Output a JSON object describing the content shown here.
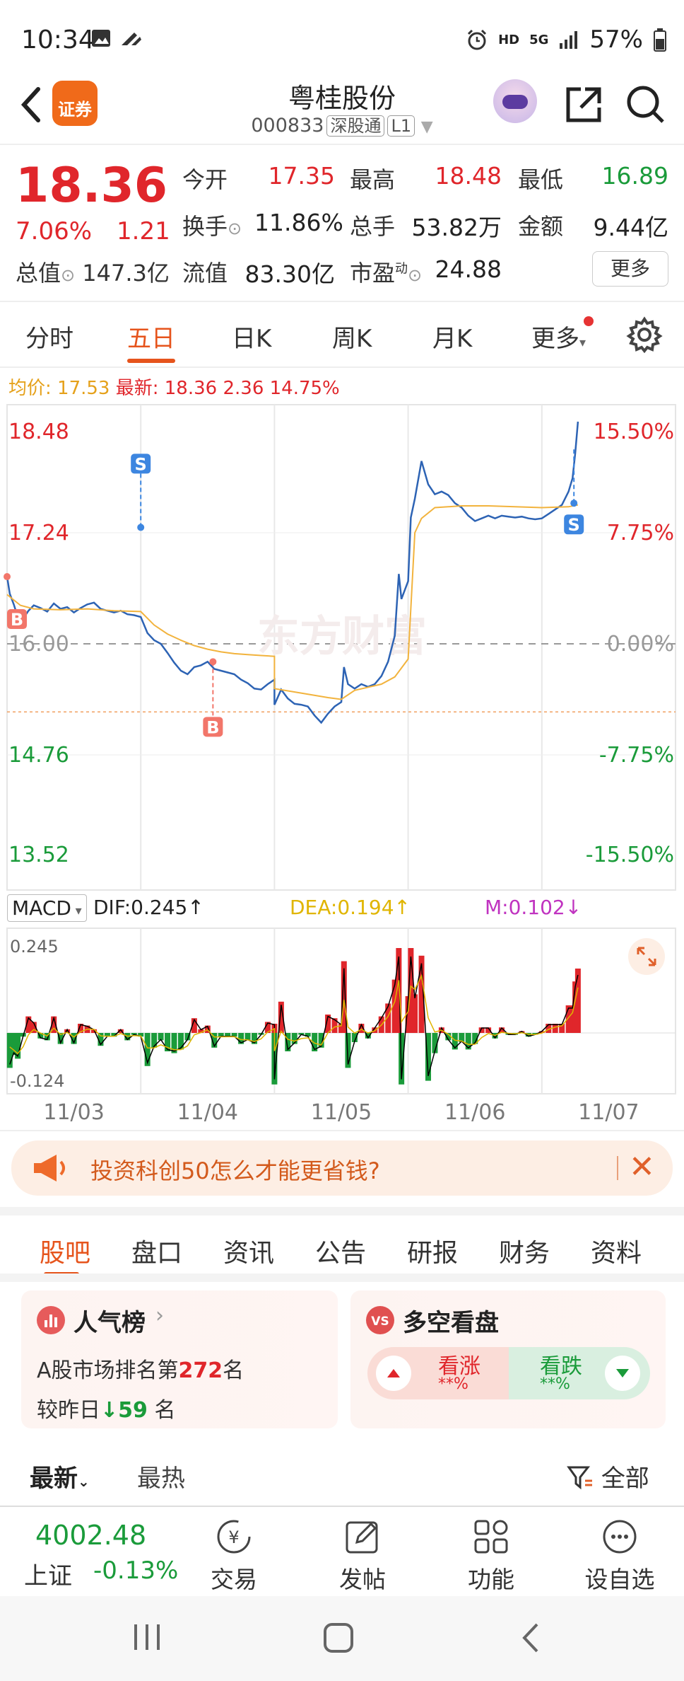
{
  "status_bar": {
    "time": "10:34",
    "network": "HD",
    "signal": "5G",
    "battery": "57%"
  },
  "header": {
    "logo_text": "证券",
    "stock_name": "粤桂股份",
    "stock_code": "000833",
    "market_tag": "深股通",
    "level_tag": "L1"
  },
  "quote": {
    "price": "18.36",
    "change_pct": "7.06%",
    "change": "1.21",
    "open_label": "今开",
    "open": "17.35",
    "high_label": "最高",
    "high": "18.48",
    "low_label": "最低",
    "low": "16.89",
    "turnover_label": "换手",
    "turnover": "11.86%",
    "volume_label": "总手",
    "volume": "53.82万",
    "amount_label": "金额",
    "amount": "9.44亿",
    "total_mv_label": "总值",
    "total_mv": "147.3亿",
    "float_mv_label": "流值",
    "float_mv": "83.30亿",
    "pe_label": "市盈",
    "pe_sup": "动",
    "pe": "24.88",
    "more_label": "更多",
    "colors": {
      "up": "#e0262b",
      "down": "#1a9b3a"
    }
  },
  "tabs": [
    "分时",
    "五日",
    "日K",
    "周K",
    "月K",
    "更多"
  ],
  "active_tab": "五日",
  "chart_info": {
    "avg_label": "均价:",
    "avg_value": "17.53",
    "latest_label": "最新:",
    "latest_value": "18.36",
    "latest_change": "2.36",
    "latest_pct": "14.75%"
  },
  "chart_data": {
    "type": "line",
    "y_left_ticks": [
      "18.48",
      "17.24",
      "16.00",
      "14.76",
      "13.52"
    ],
    "y_right_ticks": [
      "15.50%",
      "7.75%",
      "0.00%",
      "-7.75%",
      "-15.50%"
    ],
    "ylim": [
      13.52,
      18.48
    ],
    "prev_close": 16.0,
    "x_labels": [
      "11/03",
      "11/04",
      "11/05",
      "11/06",
      "11/07"
    ],
    "watermark": "东方财富",
    "markers": [
      {
        "label": "S",
        "type": "sell",
        "day": 1.0,
        "price": 17.3
      },
      {
        "label": "B",
        "type": "buy",
        "day": 1.54,
        "price": 15.8
      },
      {
        "label": "B",
        "type": "buy",
        "day": 0.0,
        "price": 16.75
      },
      {
        "label": "S",
        "type": "sell",
        "day": 4.24,
        "price": 17.57
      }
    ],
    "series": [
      {
        "name": "price",
        "color": "#2d63b4",
        "points": [
          [
            0.0,
            16.75
          ],
          [
            0.02,
            16.56
          ],
          [
            0.05,
            16.44
          ],
          [
            0.08,
            16.3
          ],
          [
            0.12,
            16.28
          ],
          [
            0.16,
            16.37
          ],
          [
            0.2,
            16.43
          ],
          [
            0.25,
            16.4
          ],
          [
            0.3,
            16.36
          ],
          [
            0.35,
            16.45
          ],
          [
            0.4,
            16.39
          ],
          [
            0.45,
            16.41
          ],
          [
            0.5,
            16.35
          ],
          [
            0.55,
            16.4
          ],
          [
            0.6,
            16.44
          ],
          [
            0.65,
            16.46
          ],
          [
            0.7,
            16.39
          ],
          [
            0.75,
            16.37
          ],
          [
            0.8,
            16.35
          ],
          [
            0.85,
            16.37
          ],
          [
            0.9,
            16.33
          ],
          [
            0.95,
            16.32
          ],
          [
            1.0,
            16.3
          ],
          [
            1.05,
            16.12
          ],
          [
            1.1,
            16.04
          ],
          [
            1.15,
            16.0
          ],
          [
            1.2,
            15.9
          ],
          [
            1.25,
            15.79
          ],
          [
            1.3,
            15.7
          ],
          [
            1.35,
            15.66
          ],
          [
            1.4,
            15.74
          ],
          [
            1.45,
            15.76
          ],
          [
            1.5,
            15.8
          ],
          [
            1.55,
            15.72
          ],
          [
            1.6,
            15.7
          ],
          [
            1.65,
            15.68
          ],
          [
            1.7,
            15.66
          ],
          [
            1.75,
            15.6
          ],
          [
            1.8,
            15.56
          ],
          [
            1.85,
            15.5
          ],
          [
            1.9,
            15.49
          ],
          [
            1.95,
            15.55
          ],
          [
            2.0,
            15.6
          ],
          [
            2.0,
            15.32
          ],
          [
            2.05,
            15.49
          ],
          [
            2.1,
            15.39
          ],
          [
            2.15,
            15.33
          ],
          [
            2.2,
            15.32
          ],
          [
            2.25,
            15.3
          ],
          [
            2.3,
            15.2
          ],
          [
            2.35,
            15.12
          ],
          [
            2.4,
            15.22
          ],
          [
            2.45,
            15.3
          ],
          [
            2.5,
            15.35
          ],
          [
            2.52,
            15.74
          ],
          [
            2.55,
            15.55
          ],
          [
            2.6,
            15.5
          ],
          [
            2.65,
            15.55
          ],
          [
            2.7,
            15.52
          ],
          [
            2.75,
            15.55
          ],
          [
            2.8,
            15.64
          ],
          [
            2.85,
            15.8
          ],
          [
            2.9,
            16.09
          ],
          [
            2.93,
            16.78
          ],
          [
            2.95,
            16.5
          ],
          [
            3.0,
            16.7
          ],
          [
            3.02,
            17.41
          ],
          [
            3.05,
            17.62
          ],
          [
            3.1,
            18.04
          ],
          [
            3.15,
            17.78
          ],
          [
            3.2,
            17.67
          ],
          [
            3.25,
            17.7
          ],
          [
            3.3,
            17.66
          ],
          [
            3.35,
            17.57
          ],
          [
            3.4,
            17.52
          ],
          [
            3.45,
            17.43
          ],
          [
            3.5,
            17.37
          ],
          [
            3.55,
            17.4
          ],
          [
            3.6,
            17.43
          ],
          [
            3.65,
            17.4
          ],
          [
            3.7,
            17.43
          ],
          [
            3.75,
            17.42
          ],
          [
            3.8,
            17.41
          ],
          [
            3.85,
            17.42
          ],
          [
            3.9,
            17.4
          ],
          [
            3.95,
            17.39
          ],
          [
            4.0,
            17.4
          ],
          [
            4.05,
            17.45
          ],
          [
            4.1,
            17.5
          ],
          [
            4.15,
            17.55
          ],
          [
            4.2,
            17.7
          ],
          [
            4.23,
            17.85
          ],
          [
            4.25,
            18.13
          ],
          [
            4.27,
            18.48
          ]
        ]
      },
      {
        "name": "avg",
        "color": "#f2b33d",
        "points": [
          [
            0.0,
            16.55
          ],
          [
            0.1,
            16.43
          ],
          [
            0.2,
            16.39
          ],
          [
            0.4,
            16.38
          ],
          [
            0.6,
            16.39
          ],
          [
            0.8,
            16.37
          ],
          [
            1.0,
            16.36
          ],
          [
            1.1,
            16.21
          ],
          [
            1.2,
            16.11
          ],
          [
            1.3,
            16.04
          ],
          [
            1.4,
            15.98
          ],
          [
            1.5,
            15.94
          ],
          [
            1.6,
            15.91
          ],
          [
            1.7,
            15.89
          ],
          [
            1.8,
            15.88
          ],
          [
            1.9,
            15.87
          ],
          [
            2.0,
            15.86
          ],
          [
            2.0,
            15.5
          ],
          [
            2.2,
            15.45
          ],
          [
            2.4,
            15.4
          ],
          [
            2.5,
            15.38
          ],
          [
            2.6,
            15.48
          ],
          [
            2.8,
            15.55
          ],
          [
            2.9,
            15.63
          ],
          [
            3.0,
            15.83
          ],
          [
            3.05,
            17.24
          ],
          [
            3.1,
            17.4
          ],
          [
            3.2,
            17.52
          ],
          [
            3.4,
            17.54
          ],
          [
            3.6,
            17.54
          ],
          [
            3.8,
            17.53
          ],
          [
            4.0,
            17.52
          ],
          [
            4.2,
            17.53
          ],
          [
            4.27,
            17.55
          ]
        ]
      }
    ]
  },
  "macd": {
    "indicator": "MACD",
    "dif_label": "DIF:0.245",
    "dea_label": "DEA:0.194",
    "m_label": "M:0.102",
    "y_top": "0.245",
    "y_bottom": "-0.124",
    "colors": {
      "dif": "#000000",
      "dea": "#e0b500",
      "m": "#c033c0"
    }
  },
  "banner": {
    "text": "投资科创50怎么才能更省钱?"
  },
  "section_tabs": [
    "股吧",
    "盘口",
    "资讯",
    "公告",
    "研报",
    "财务",
    "资料"
  ],
  "active_section": "股吧",
  "popularity": {
    "title": "人气榜",
    "rank_prefix": "A股市场排名第",
    "rank": "272",
    "rank_suffix": "名",
    "change_prefix": "较昨日",
    "change": "59",
    "change_suffix": "名"
  },
  "sentiment": {
    "title": "多空看盘",
    "rise_label": "看涨",
    "rise_value": "**%",
    "fall_label": "看跌",
    "fall_value": "**%"
  },
  "sort": {
    "latest": "最新",
    "hottest": "最热",
    "filter": "全部"
  },
  "bottom_nav": {
    "index_value": "4002.48",
    "index_name": "上证",
    "index_change": "-0.13%",
    "items": [
      "交易",
      "发帖",
      "功能",
      "设自选"
    ]
  }
}
